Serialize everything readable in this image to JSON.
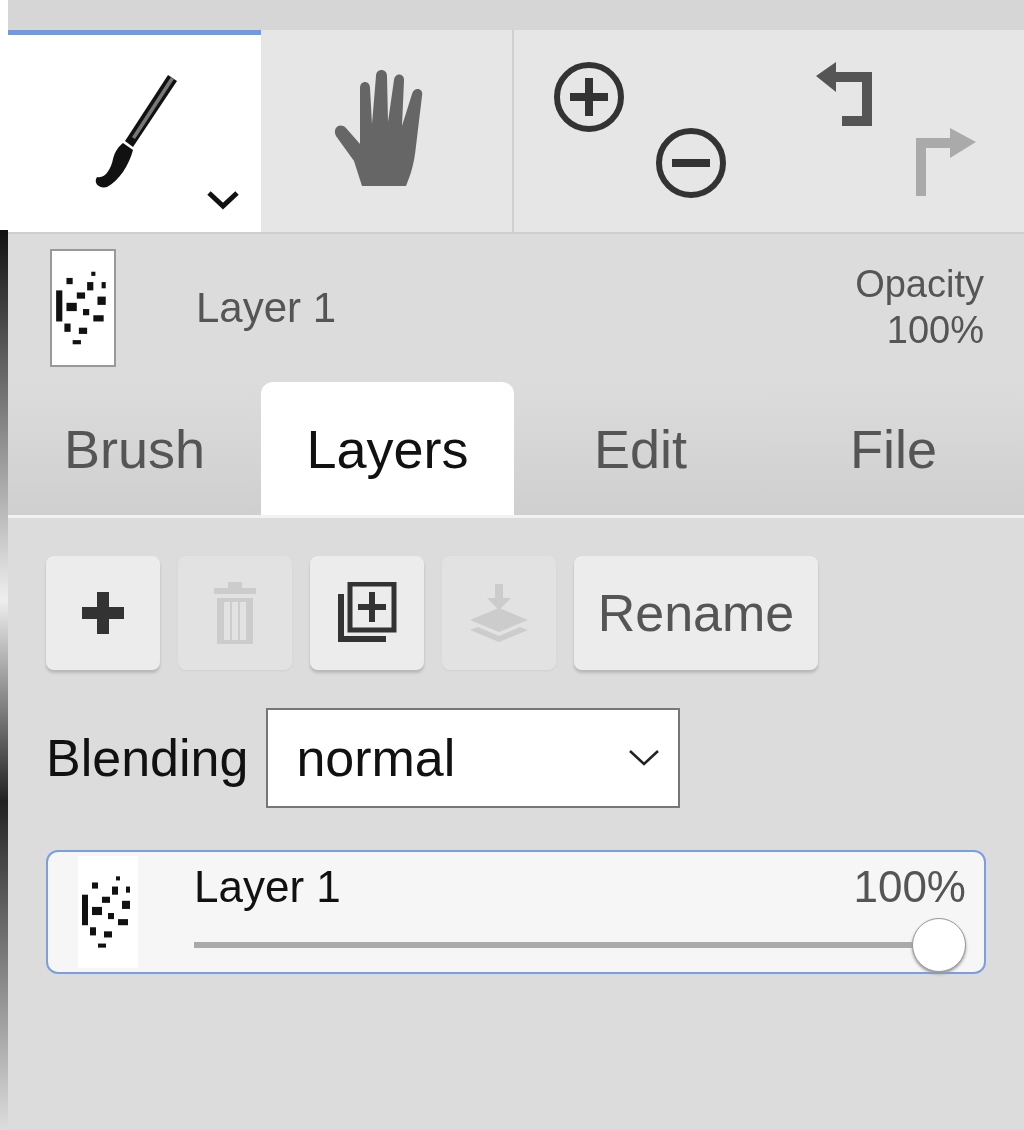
{
  "tools": [
    {
      "kind": "brush",
      "selected": true
    },
    {
      "kind": "hand",
      "selected": false
    }
  ],
  "history": [
    {
      "kind": "undo",
      "disabled": false
    },
    {
      "kind": "redo",
      "disabled": true
    }
  ],
  "current_layer": {
    "name": "Layer 1",
    "opacity_label": "Opacity",
    "opacity_value": "100%"
  },
  "tabs": [
    {
      "label": "Brush",
      "selected": false
    },
    {
      "label": "Layers",
      "selected": true
    },
    {
      "label": "Edit",
      "selected": false
    },
    {
      "label": "File",
      "selected": false
    }
  ],
  "actions": [
    {
      "kind": "add",
      "disabled": false
    },
    {
      "kind": "delete",
      "disabled": true
    },
    {
      "kind": "duplicate",
      "disabled": false
    },
    {
      "kind": "merge",
      "disabled": true
    },
    {
      "kind": "text",
      "label": "Rename",
      "disabled": false
    }
  ],
  "blending": {
    "label": "Blending",
    "value": "normal"
  },
  "layers": [
    {
      "name": "Layer 1",
      "opacity": "100%",
      "level": 1,
      "selected": true
    }
  ]
}
